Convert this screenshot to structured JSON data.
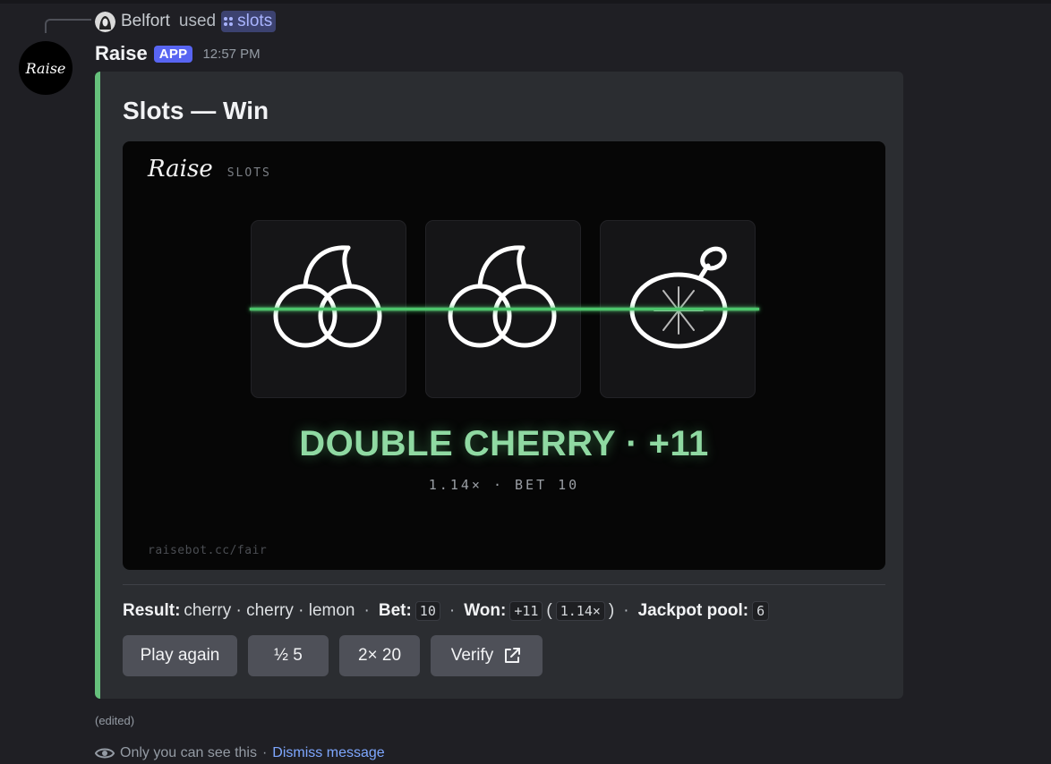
{
  "reply": {
    "user_name": "Belfort",
    "used_text": "used",
    "command": "slots"
  },
  "message": {
    "bot_name": "Raise",
    "badge": "APP",
    "timestamp": "12:57 PM",
    "avatar_text": "Raise"
  },
  "embed": {
    "accent_color": "#66c07c",
    "title": "Slots — Win",
    "image": {
      "brand_logo": "Raise",
      "brand_sub": "SLOTS",
      "reels": [
        "cherry",
        "cherry",
        "lemon"
      ],
      "result_text": "DOUBLE CHERRY · +11",
      "result_sub": "1.14× · BET 10",
      "footer_url": "raisebot.cc/fair"
    },
    "fields": {
      "result_label": "Result:",
      "result_value": "cherry · cherry · lemon",
      "bet_label": "Bet:",
      "bet_value": "10",
      "won_label": "Won:",
      "won_value": "+11",
      "multiplier": "1.14×",
      "jackpot_label": "Jackpot pool:",
      "jackpot_value": "6"
    },
    "buttons": {
      "play_again": "Play again",
      "half": "½ 5",
      "double": "2× 20",
      "verify": "Verify"
    }
  },
  "edited_label": "(edited)",
  "ephemeral": {
    "notice": "Only you can see this",
    "dismiss": "Dismiss message"
  }
}
